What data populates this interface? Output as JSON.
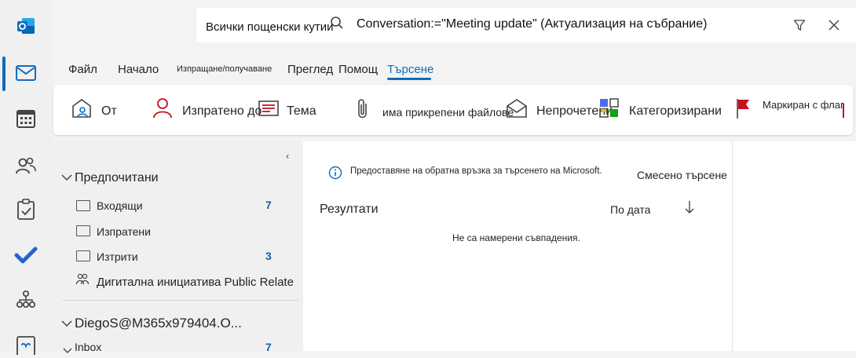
{
  "search": {
    "scope": "Всички пощенски кутии",
    "query": "Conversation:=\"Meeting update\" (Актуализация на събрание)"
  },
  "menu": {
    "file": "Файл",
    "home": "Начало",
    "send_receive": "Изпращане/получаване",
    "view": "Преглед",
    "help": "Помощ",
    "search": "Търсене"
  },
  "ribbon": {
    "from": "От",
    "sent_to": "Изпратено до",
    "subject": "Тема",
    "has_attachments": "има прикрепени файлове",
    "unread": "Непрочетени",
    "categorized": "Категоризирани",
    "flagged": "Маркиран с флаг"
  },
  "folders": {
    "favorites_header": "Предпочитани",
    "items": [
      {
        "label": "Входящи",
        "count": "7"
      },
      {
        "label": "Изпратени",
        "count": ""
      },
      {
        "label": "Изтрити",
        "count": "3"
      }
    ],
    "group_label": "Дигитална инициатива Public Relate",
    "account": "DiegoS@M365x979404.O...",
    "inbox_label": "Inbox",
    "inbox_count": "7"
  },
  "results": {
    "feedback": "Предоставяне на обратна връзка за търсенето на Microsoft.",
    "mixed_search": "Смесено търсене",
    "header": "Резултати",
    "sort_label": "По дата",
    "empty_message": "Не са намерени съвпадения."
  },
  "colors": {
    "accent": "#0f6cbd",
    "count": "#115ea3",
    "flag": "#c50f1f"
  }
}
